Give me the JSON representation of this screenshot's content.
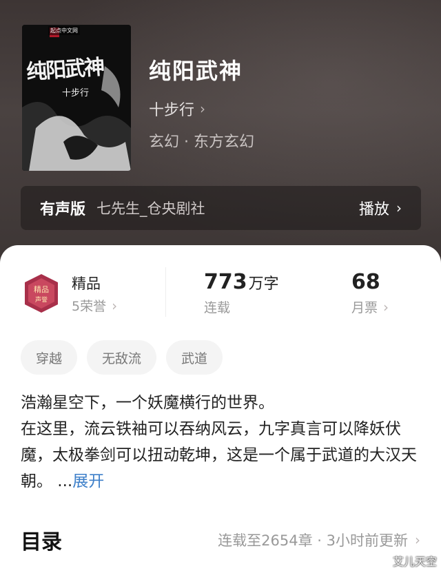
{
  "book": {
    "title": "纯阳武神",
    "author": "十步行",
    "genre": "玄幻 · 东方玄幻",
    "cover": {
      "title": "纯阳武神",
      "author": "十步行",
      "badge": "起点中文网"
    }
  },
  "audio": {
    "label": "有声版",
    "narrator": "七先生_仓央剧社",
    "play_label": "播放"
  },
  "stats": {
    "honor": {
      "name": "精品",
      "count": "5荣誉"
    },
    "words": {
      "value": "773",
      "unit": "万字",
      "status": "连载"
    },
    "tickets": {
      "value": "68",
      "label": "月票"
    }
  },
  "tags": [
    "穿越",
    "无敌流",
    "武道"
  ],
  "synopsis": {
    "text": "浩瀚星空下，一个妖魔横行的世界。\n在这里，流云铁袖可以吞纳风云，九字真言可以降妖伏魔，太极拳剑可以扭动乾坤，这是一个属于武道的大汉天朝。 ...",
    "expand_label": "展开"
  },
  "toc": {
    "title": "目录",
    "meta": "连载至2654章 · 3小时前更新"
  },
  "watermark": "艾儿天空",
  "colors": {
    "accent": "#3d7fc9",
    "hero_bg": "#3d3534",
    "sheet_bg": "#ffffff"
  }
}
